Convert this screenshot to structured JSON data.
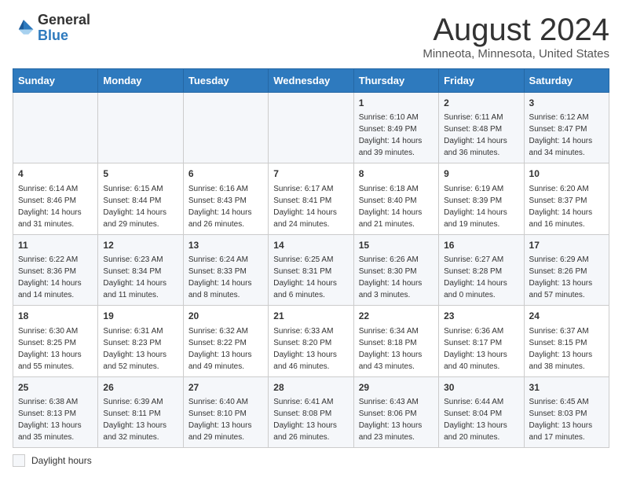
{
  "header": {
    "logo_general": "General",
    "logo_blue": "Blue",
    "title": "August 2024",
    "subtitle": "Minneota, Minnesota, United States"
  },
  "days_of_week": [
    "Sunday",
    "Monday",
    "Tuesday",
    "Wednesday",
    "Thursday",
    "Friday",
    "Saturday"
  ],
  "weeks": [
    [
      {
        "day": "",
        "detail": ""
      },
      {
        "day": "",
        "detail": ""
      },
      {
        "day": "",
        "detail": ""
      },
      {
        "day": "",
        "detail": ""
      },
      {
        "day": "1",
        "detail": "Sunrise: 6:10 AM\nSunset: 8:49 PM\nDaylight: 14 hours and 39 minutes."
      },
      {
        "day": "2",
        "detail": "Sunrise: 6:11 AM\nSunset: 8:48 PM\nDaylight: 14 hours and 36 minutes."
      },
      {
        "day": "3",
        "detail": "Sunrise: 6:12 AM\nSunset: 8:47 PM\nDaylight: 14 hours and 34 minutes."
      }
    ],
    [
      {
        "day": "4",
        "detail": "Sunrise: 6:14 AM\nSunset: 8:46 PM\nDaylight: 14 hours and 31 minutes."
      },
      {
        "day": "5",
        "detail": "Sunrise: 6:15 AM\nSunset: 8:44 PM\nDaylight: 14 hours and 29 minutes."
      },
      {
        "day": "6",
        "detail": "Sunrise: 6:16 AM\nSunset: 8:43 PM\nDaylight: 14 hours and 26 minutes."
      },
      {
        "day": "7",
        "detail": "Sunrise: 6:17 AM\nSunset: 8:41 PM\nDaylight: 14 hours and 24 minutes."
      },
      {
        "day": "8",
        "detail": "Sunrise: 6:18 AM\nSunset: 8:40 PM\nDaylight: 14 hours and 21 minutes."
      },
      {
        "day": "9",
        "detail": "Sunrise: 6:19 AM\nSunset: 8:39 PM\nDaylight: 14 hours and 19 minutes."
      },
      {
        "day": "10",
        "detail": "Sunrise: 6:20 AM\nSunset: 8:37 PM\nDaylight: 14 hours and 16 minutes."
      }
    ],
    [
      {
        "day": "11",
        "detail": "Sunrise: 6:22 AM\nSunset: 8:36 PM\nDaylight: 14 hours and 14 minutes."
      },
      {
        "day": "12",
        "detail": "Sunrise: 6:23 AM\nSunset: 8:34 PM\nDaylight: 14 hours and 11 minutes."
      },
      {
        "day": "13",
        "detail": "Sunrise: 6:24 AM\nSunset: 8:33 PM\nDaylight: 14 hours and 8 minutes."
      },
      {
        "day": "14",
        "detail": "Sunrise: 6:25 AM\nSunset: 8:31 PM\nDaylight: 14 hours and 6 minutes."
      },
      {
        "day": "15",
        "detail": "Sunrise: 6:26 AM\nSunset: 8:30 PM\nDaylight: 14 hours and 3 minutes."
      },
      {
        "day": "16",
        "detail": "Sunrise: 6:27 AM\nSunset: 8:28 PM\nDaylight: 14 hours and 0 minutes."
      },
      {
        "day": "17",
        "detail": "Sunrise: 6:29 AM\nSunset: 8:26 PM\nDaylight: 13 hours and 57 minutes."
      }
    ],
    [
      {
        "day": "18",
        "detail": "Sunrise: 6:30 AM\nSunset: 8:25 PM\nDaylight: 13 hours and 55 minutes."
      },
      {
        "day": "19",
        "detail": "Sunrise: 6:31 AM\nSunset: 8:23 PM\nDaylight: 13 hours and 52 minutes."
      },
      {
        "day": "20",
        "detail": "Sunrise: 6:32 AM\nSunset: 8:22 PM\nDaylight: 13 hours and 49 minutes."
      },
      {
        "day": "21",
        "detail": "Sunrise: 6:33 AM\nSunset: 8:20 PM\nDaylight: 13 hours and 46 minutes."
      },
      {
        "day": "22",
        "detail": "Sunrise: 6:34 AM\nSunset: 8:18 PM\nDaylight: 13 hours and 43 minutes."
      },
      {
        "day": "23",
        "detail": "Sunrise: 6:36 AM\nSunset: 8:17 PM\nDaylight: 13 hours and 40 minutes."
      },
      {
        "day": "24",
        "detail": "Sunrise: 6:37 AM\nSunset: 8:15 PM\nDaylight: 13 hours and 38 minutes."
      }
    ],
    [
      {
        "day": "25",
        "detail": "Sunrise: 6:38 AM\nSunset: 8:13 PM\nDaylight: 13 hours and 35 minutes."
      },
      {
        "day": "26",
        "detail": "Sunrise: 6:39 AM\nSunset: 8:11 PM\nDaylight: 13 hours and 32 minutes."
      },
      {
        "day": "27",
        "detail": "Sunrise: 6:40 AM\nSunset: 8:10 PM\nDaylight: 13 hours and 29 minutes."
      },
      {
        "day": "28",
        "detail": "Sunrise: 6:41 AM\nSunset: 8:08 PM\nDaylight: 13 hours and 26 minutes."
      },
      {
        "day": "29",
        "detail": "Sunrise: 6:43 AM\nSunset: 8:06 PM\nDaylight: 13 hours and 23 minutes."
      },
      {
        "day": "30",
        "detail": "Sunrise: 6:44 AM\nSunset: 8:04 PM\nDaylight: 13 hours and 20 minutes."
      },
      {
        "day": "31",
        "detail": "Sunrise: 6:45 AM\nSunset: 8:03 PM\nDaylight: 13 hours and 17 minutes."
      }
    ]
  ],
  "legend": {
    "label": "Daylight hours"
  }
}
